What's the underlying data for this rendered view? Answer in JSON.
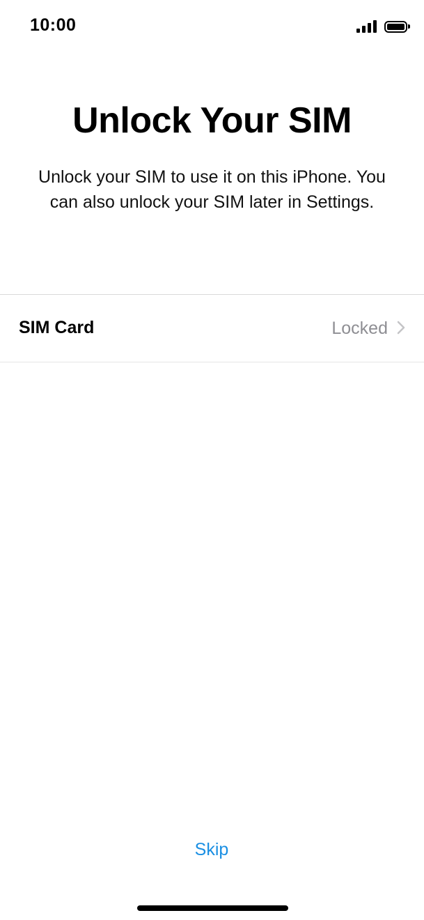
{
  "status_bar": {
    "time": "10:00",
    "signal_icon": "cellular-signal-icon",
    "battery_icon": "battery-full-icon"
  },
  "header": {
    "title": "Unlock Your SIM",
    "description": "Unlock your SIM to use it on this iPhone. You can also unlock your SIM later in Settings."
  },
  "sim_row": {
    "label": "SIM Card",
    "value": "Locked",
    "chevron_icon": "chevron-right-icon"
  },
  "footer": {
    "skip_label": "Skip"
  },
  "colors": {
    "accent": "#1a8fe3",
    "secondary_text": "#8e8e93",
    "divider": "#d9d9d9"
  }
}
